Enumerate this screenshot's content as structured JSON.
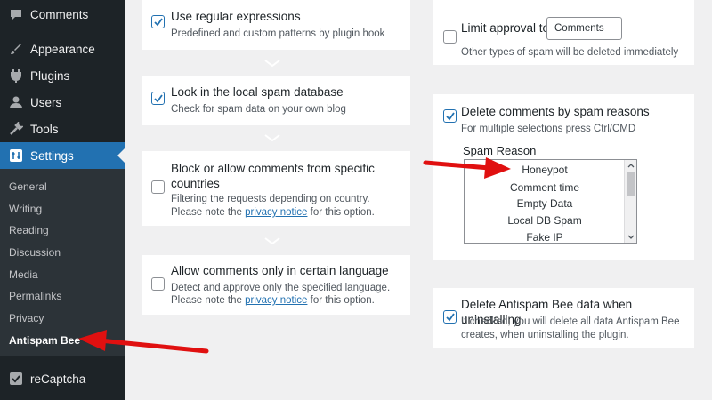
{
  "sidebar": {
    "menu": [
      {
        "label": "Comments",
        "icon": "comments-icon"
      },
      {
        "label": "Appearance",
        "icon": "appearance-icon"
      },
      {
        "label": "Plugins",
        "icon": "plugins-icon"
      },
      {
        "label": "Users",
        "icon": "users-icon"
      },
      {
        "label": "Tools",
        "icon": "tools-icon"
      },
      {
        "label": "Settings",
        "icon": "settings-icon"
      },
      {
        "label": "reCaptcha",
        "icon": "recaptcha-icon"
      }
    ],
    "submenu": [
      "General",
      "Writing",
      "Reading",
      "Discussion",
      "Media",
      "Permalinks",
      "Privacy",
      "Antispam Bee"
    ],
    "current_submenu": "Antispam Bee"
  },
  "left_column": {
    "regex": {
      "title": "Use regular expressions",
      "desc": "Predefined and custom patterns by plugin hook",
      "checked": true
    },
    "local_db": {
      "title": "Look in the local spam database",
      "desc": "Check for spam data on your own blog",
      "checked": true
    },
    "country": {
      "title_line1": "Block or allow comments from specific",
      "title_line2": "countries",
      "desc_line1": "Filtering the requests depending on country.",
      "desc_pre": "Please note the ",
      "desc_link": "privacy notice",
      "desc_post": " for this option.",
      "checked": false
    },
    "language": {
      "title": "Allow comments only in certain language",
      "desc_line1": "Detect and approve only the specified language.",
      "desc_pre": "Please note the ",
      "desc_link": "privacy notice",
      "desc_post": " for this option.",
      "checked": false
    }
  },
  "right_column": {
    "limit_approval": {
      "title": "Limit approval to",
      "select_value": "Comments",
      "desc": "Other types of spam will be deleted immediately",
      "checked": false
    },
    "delete_by_reason": {
      "title": "Delete comments by spam reasons",
      "desc": "For multiple selections press Ctrl/CMD",
      "checked": true,
      "list_label": "Spam Reason",
      "options": [
        "Honeypot",
        "Comment time",
        "Empty Data",
        "Local DB Spam",
        "Fake IP"
      ]
    },
    "delete_on_uninstall": {
      "title": "Delete Antispam Bee data when uninstalling",
      "desc_line1": "If checked, you will delete all data Antispam Bee",
      "desc_line2": "creates, when uninstalling the plugin.",
      "checked": true
    }
  },
  "colors": {
    "sidebar_bg": "#1d2327",
    "submenu_bg": "#2c3338",
    "accent": "#2271b1",
    "arrow": "#e01010"
  }
}
